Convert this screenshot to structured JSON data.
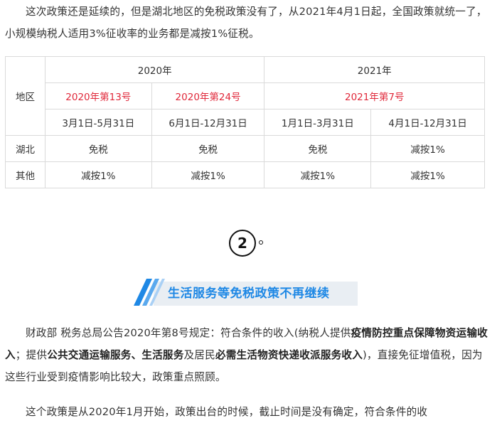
{
  "intro_paragraph": "这次政策还是延续的，但是湖北地区的免税政策没有了，从2021年4月1日起，全国政策就统一了，小规模纳税人适用3%征收率的业务都是减按1%征税。",
  "table": {
    "region_header": "地区",
    "year_2020": "2020年",
    "year_2021": "2021年",
    "notices": [
      "2020年第13号",
      "2020年第24号",
      "2021年第7号"
    ],
    "periods": [
      "3月1日-5月31日",
      "6月1日-12月31日",
      "1月1日-3月31日",
      "4月1日-12月31日"
    ],
    "rows": [
      {
        "region": "湖北",
        "values": [
          "免税",
          "免税",
          "免税",
          "减按1%"
        ]
      },
      {
        "region": "其他",
        "values": [
          "减按1%",
          "减按1%",
          "减按1%",
          "减按1%"
        ]
      }
    ],
    "notice_color": "#e0283a"
  },
  "section": {
    "number": "2",
    "title": "生活服务等免税政策不再继续",
    "title_color": "#1e88e5"
  },
  "paragraph2": {
    "t1": "财政部 税务总局公告2020年第8号规定：符合条件的收入(纳税人提供",
    "b1": "疫情防控重点保障物资运输收入",
    "t2": "；提供",
    "b2": "公共交通运输服务、生活服务",
    "t3": "及居民",
    "b3": "必需生活物资快递收派服务收入",
    "t4": ")，直接免征增值税，因为这些行业受到疫情影响比较大，政策重点照顾。"
  },
  "paragraph3": "这个政策是从2020年1月开始，政策出台的时候，截止时间是没有确定，符合条件的收"
}
